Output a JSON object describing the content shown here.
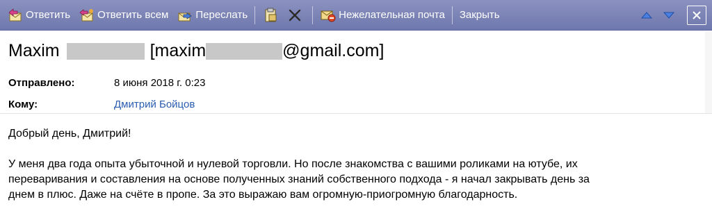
{
  "toolbar": {
    "reply_label": "Ответить",
    "reply_all_label": "Ответить всем",
    "forward_label": "Переслать",
    "junk_label": "Нежелательная почта",
    "close_label": "Закрыть"
  },
  "message": {
    "sender_name": "Maxim",
    "sender_email_open": "[maxim",
    "sender_email_domain": "@gmail.com]",
    "sent_label": "Отправлено:",
    "sent_value": "8 июня 2018 г. 0:23",
    "to_label": "Кому:",
    "to_value": "Дмитрий Бойцов"
  },
  "body": {
    "greeting": "Добрый день, Дмитрий!",
    "line1": "У меня два года опыта убыточной и нулевой торговли. Но после знакомства с вашими роликами на ютубе, их",
    "line2": "переваривания и составления на основе полученных знаний собственного подхода - я начал закрывать день за",
    "line3": "днем в плюс. Даже на счёте в пропе. За это выражаю вам огромную-приогромную благодарность."
  }
}
